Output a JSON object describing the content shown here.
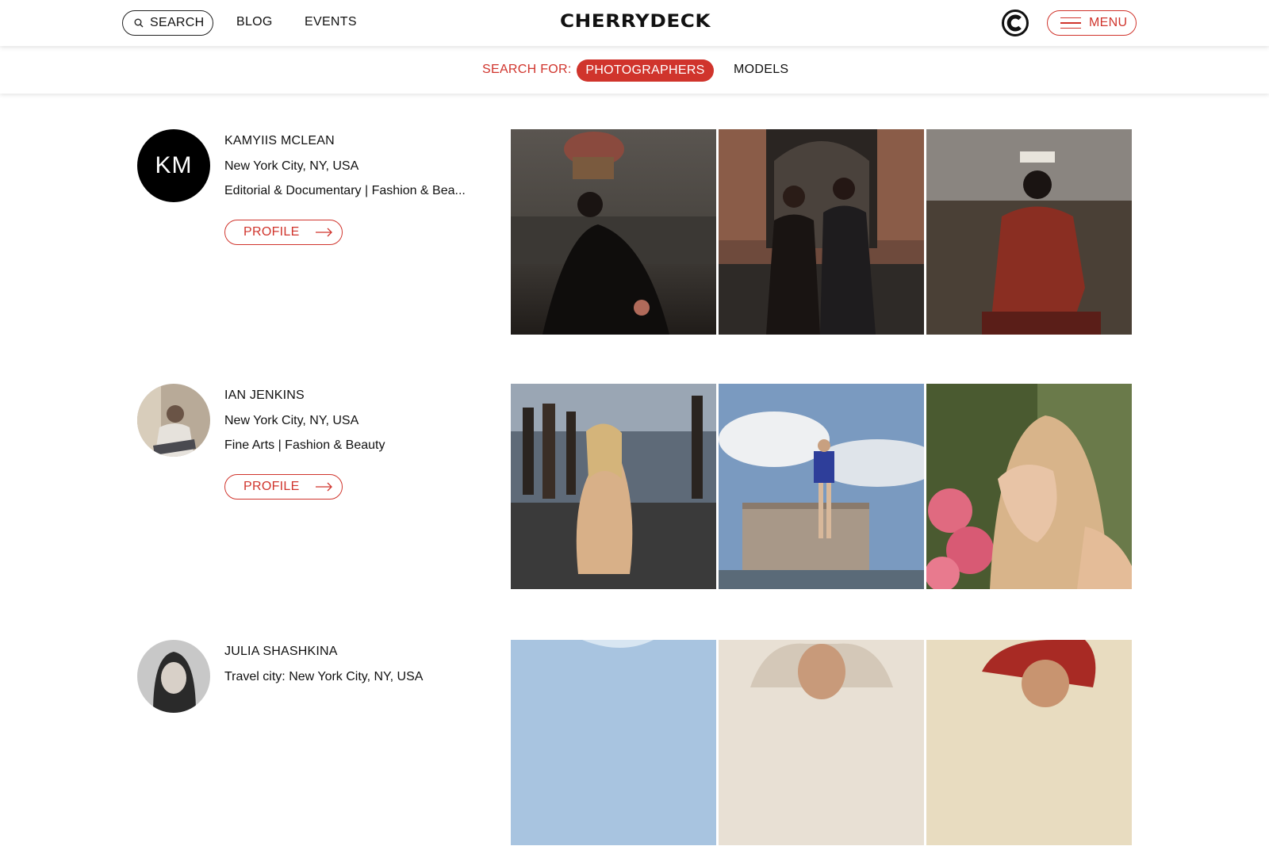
{
  "header": {
    "search_label": "SEARCH",
    "nav": [
      "BLOG",
      "EVENTS"
    ],
    "logo": "CHERRYDECK",
    "menu_label": "MENU"
  },
  "filter": {
    "label": "SEARCH FOR:",
    "active": "PHOTOGRAPHERS",
    "inactive": "MODELS"
  },
  "colors": {
    "accent": "#d0342c",
    "text": "#111111",
    "background": "#ffffff"
  },
  "profiles": [
    {
      "initials": "KM",
      "name": "KAMYIIS MCLEAN",
      "location": "New York City, NY, USA",
      "specialties": "Editorial & Documentary | Fashion & Bea...",
      "button": "PROFILE"
    },
    {
      "initials": "",
      "name": "IAN JENKINS",
      "location": "New York City, NY, USA",
      "specialties": "Fine Arts | Fashion & Beauty",
      "button": "PROFILE"
    },
    {
      "initials": "",
      "name": "JULIA SHASHKINA",
      "location": "Travel city: New York City, NY, USA",
      "specialties": "",
      "button": ""
    }
  ],
  "icons": {
    "search": "magnifier-icon",
    "brand": "cherrydeck-c-icon",
    "menu": "hamburger-icon",
    "profile_arrow": "arrow-right-icon"
  }
}
